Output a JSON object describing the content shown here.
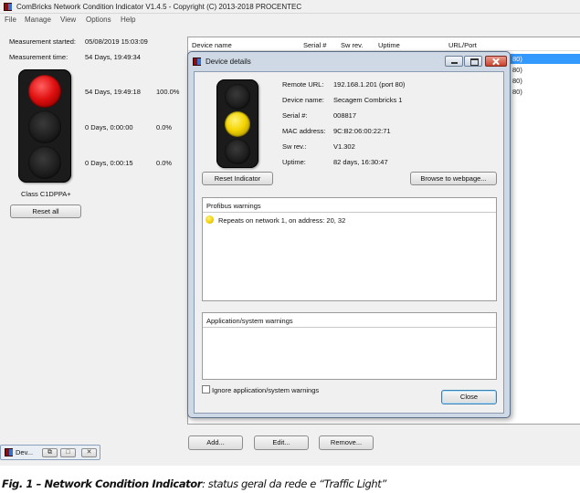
{
  "window": {
    "title": "ComBricks Network Condition Indicator V1.4.5 - Copyright (C) 2013-2018 PROCENTEC"
  },
  "menu": [
    "File",
    "Manage",
    "View",
    "Options",
    "Help"
  ],
  "left_panel": {
    "started_label": "Measurement started:",
    "started_value": "05/08/2019 15:03:09",
    "time_label": "Measurement time:",
    "time_value": "54 Days, 19:49:34",
    "rows": [
      {
        "duration": "54 Days, 19:49:18",
        "percent": "100.0%"
      },
      {
        "duration": "0 Days, 0:00:00",
        "percent": "0.0%"
      },
      {
        "duration": "0 Days, 0:00:15",
        "percent": "0.0%"
      }
    ],
    "active_lamp": "red",
    "class_label": "Class C1DPPA+",
    "reset_all": "Reset all"
  },
  "device_table": {
    "columns": [
      "Device name",
      "Serial #",
      "Sw rev.",
      "Uptime",
      "URL/Port"
    ],
    "visible_url_fragments": [
      "80)",
      "80)",
      "80)",
      "80)"
    ],
    "selected_row_index": 0
  },
  "bottom_buttons": {
    "add": "Add...",
    "edit": "Edit...",
    "remove": "Remove..."
  },
  "taskbar": {
    "label": "Dev..."
  },
  "dialog": {
    "title": "Device details",
    "active_lamp": "yellow",
    "fields": [
      {
        "label": "Remote URL:",
        "value": "192.168.1.201 (port 80)"
      },
      {
        "label": "Device name:",
        "value": "Secagem Combricks 1"
      },
      {
        "label": "Serial #:",
        "value": "008817"
      },
      {
        "label": "MAC address:",
        "value": "9C:B2:06:00:22:71"
      },
      {
        "label": "Sw rev.:",
        "value": "V1.302"
      },
      {
        "label": "Uptime:",
        "value": "82 days, 16:30:47"
      }
    ],
    "reset_indicator": "Reset Indicator",
    "browse": "Browse to webpage...",
    "profibus_title": "Profibus warnings",
    "profibus_warnings": [
      "Repeats on network 1, on address: 20, 32"
    ],
    "app_title": "Application/system warnings",
    "ignore_label": "Ignore application/system warnings",
    "ignore_checked": false,
    "close": "Close"
  },
  "caption": {
    "bold": "Fig. 1 – Network Condition Indicator",
    "rest": ": status geral da rede e “Traffic Light”"
  },
  "colors": {
    "red_lamp": "#e01010",
    "yellow_lamp": "#f4d400",
    "selection": "#3399ff"
  }
}
